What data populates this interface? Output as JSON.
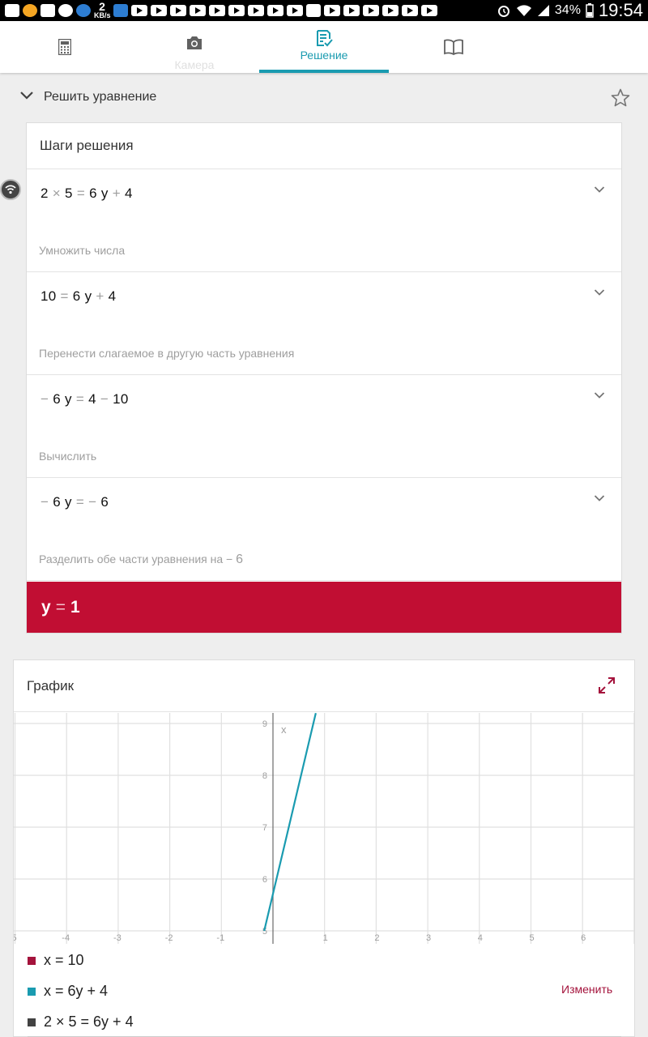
{
  "status_bar": {
    "speed_value": "2",
    "speed_unit": "KB/s",
    "battery": "34%",
    "time": "19:54"
  },
  "tabs": [
    {
      "name": "calculator",
      "icon": "calculator-icon",
      "label": ""
    },
    {
      "name": "camera",
      "icon": "camera-icon",
      "label": "Камера"
    },
    {
      "name": "solution",
      "icon": "solution-icon",
      "label": "Решение",
      "active": true
    },
    {
      "name": "book",
      "icon": "book-icon",
      "label": ""
    }
  ],
  "section": {
    "title": "Решить уравнение"
  },
  "steps_card": {
    "header": "Шаги решения",
    "steps": [
      {
        "eq_parts": [
          "2",
          " × ",
          "5",
          " = ",
          "6 y",
          " + ",
          "4"
        ],
        "desc": "Умножить числа",
        "desc_suffix": ""
      },
      {
        "eq_parts": [
          "10",
          " = ",
          "6 y",
          " + ",
          "4"
        ],
        "desc": "Перенести слагаемое в другую часть уравнения",
        "desc_suffix": ""
      },
      {
        "eq_parts": [
          "− ",
          "6 y",
          " = ",
          "4",
          " − ",
          "10"
        ],
        "desc": "Вычислить",
        "desc_suffix": ""
      },
      {
        "eq_parts": [
          "− ",
          "6 y",
          " = ",
          "− ",
          "6"
        ],
        "desc": "Разделить обе части уравнения на − ",
        "desc_suffix": "6"
      }
    ],
    "answer_var": "y",
    "answer_op": "=",
    "answer_val": "1"
  },
  "graph": {
    "title": "График",
    "x_ticks": [
      "5",
      "-4",
      "-3",
      "-2",
      "-1",
      "1",
      "2",
      "3",
      "4",
      "5",
      "6"
    ],
    "y_ticks": [
      "9",
      "8",
      "7",
      "6",
      "5"
    ],
    "axis_label": "x",
    "legend": [
      {
        "label": "x = 10",
        "color": "#a4133c"
      },
      {
        "label": "x = 6y + 4",
        "color": "#1a9bb0"
      },
      {
        "label": "2 × 5 = 6y + 4",
        "color": "#424242"
      }
    ],
    "change_link": "Изменить"
  },
  "chart_data": {
    "type": "line",
    "title": "График",
    "series": [
      {
        "name": "x = 6y + 4",
        "x": [
          -0.17,
          0.83
        ],
        "y": [
          5.0,
          9.2
        ]
      }
    ],
    "xlim": [
      -5,
      6.5
    ],
    "ylim": [
      4.8,
      9.2
    ],
    "grid": true
  },
  "colors": {
    "accent": "#1a9bb0",
    "answer_bg": "#c10e33",
    "link": "#a4133c"
  }
}
